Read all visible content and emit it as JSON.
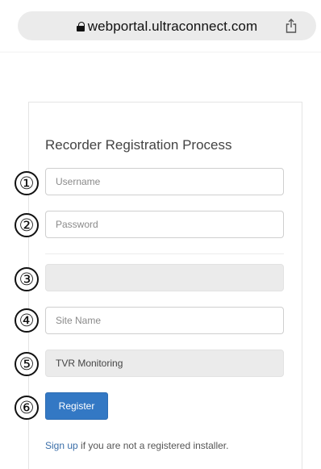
{
  "browser": {
    "url_host": "webportal.ultraconnect.com"
  },
  "form": {
    "title": "Recorder Registration Process",
    "username": {
      "placeholder": "Username",
      "value": ""
    },
    "password": {
      "placeholder": "Password",
      "value": ""
    },
    "field3": {
      "value": ""
    },
    "site_name": {
      "placeholder": "Site Name",
      "value": ""
    },
    "monitoring": {
      "value": "TVR Monitoring"
    },
    "register_label": "Register",
    "signup": {
      "link_text": "Sign up",
      "rest_text": " if you are not a registered installer."
    }
  },
  "markers": [
    "①",
    "②",
    "③",
    "④",
    "⑤",
    "⑥"
  ]
}
